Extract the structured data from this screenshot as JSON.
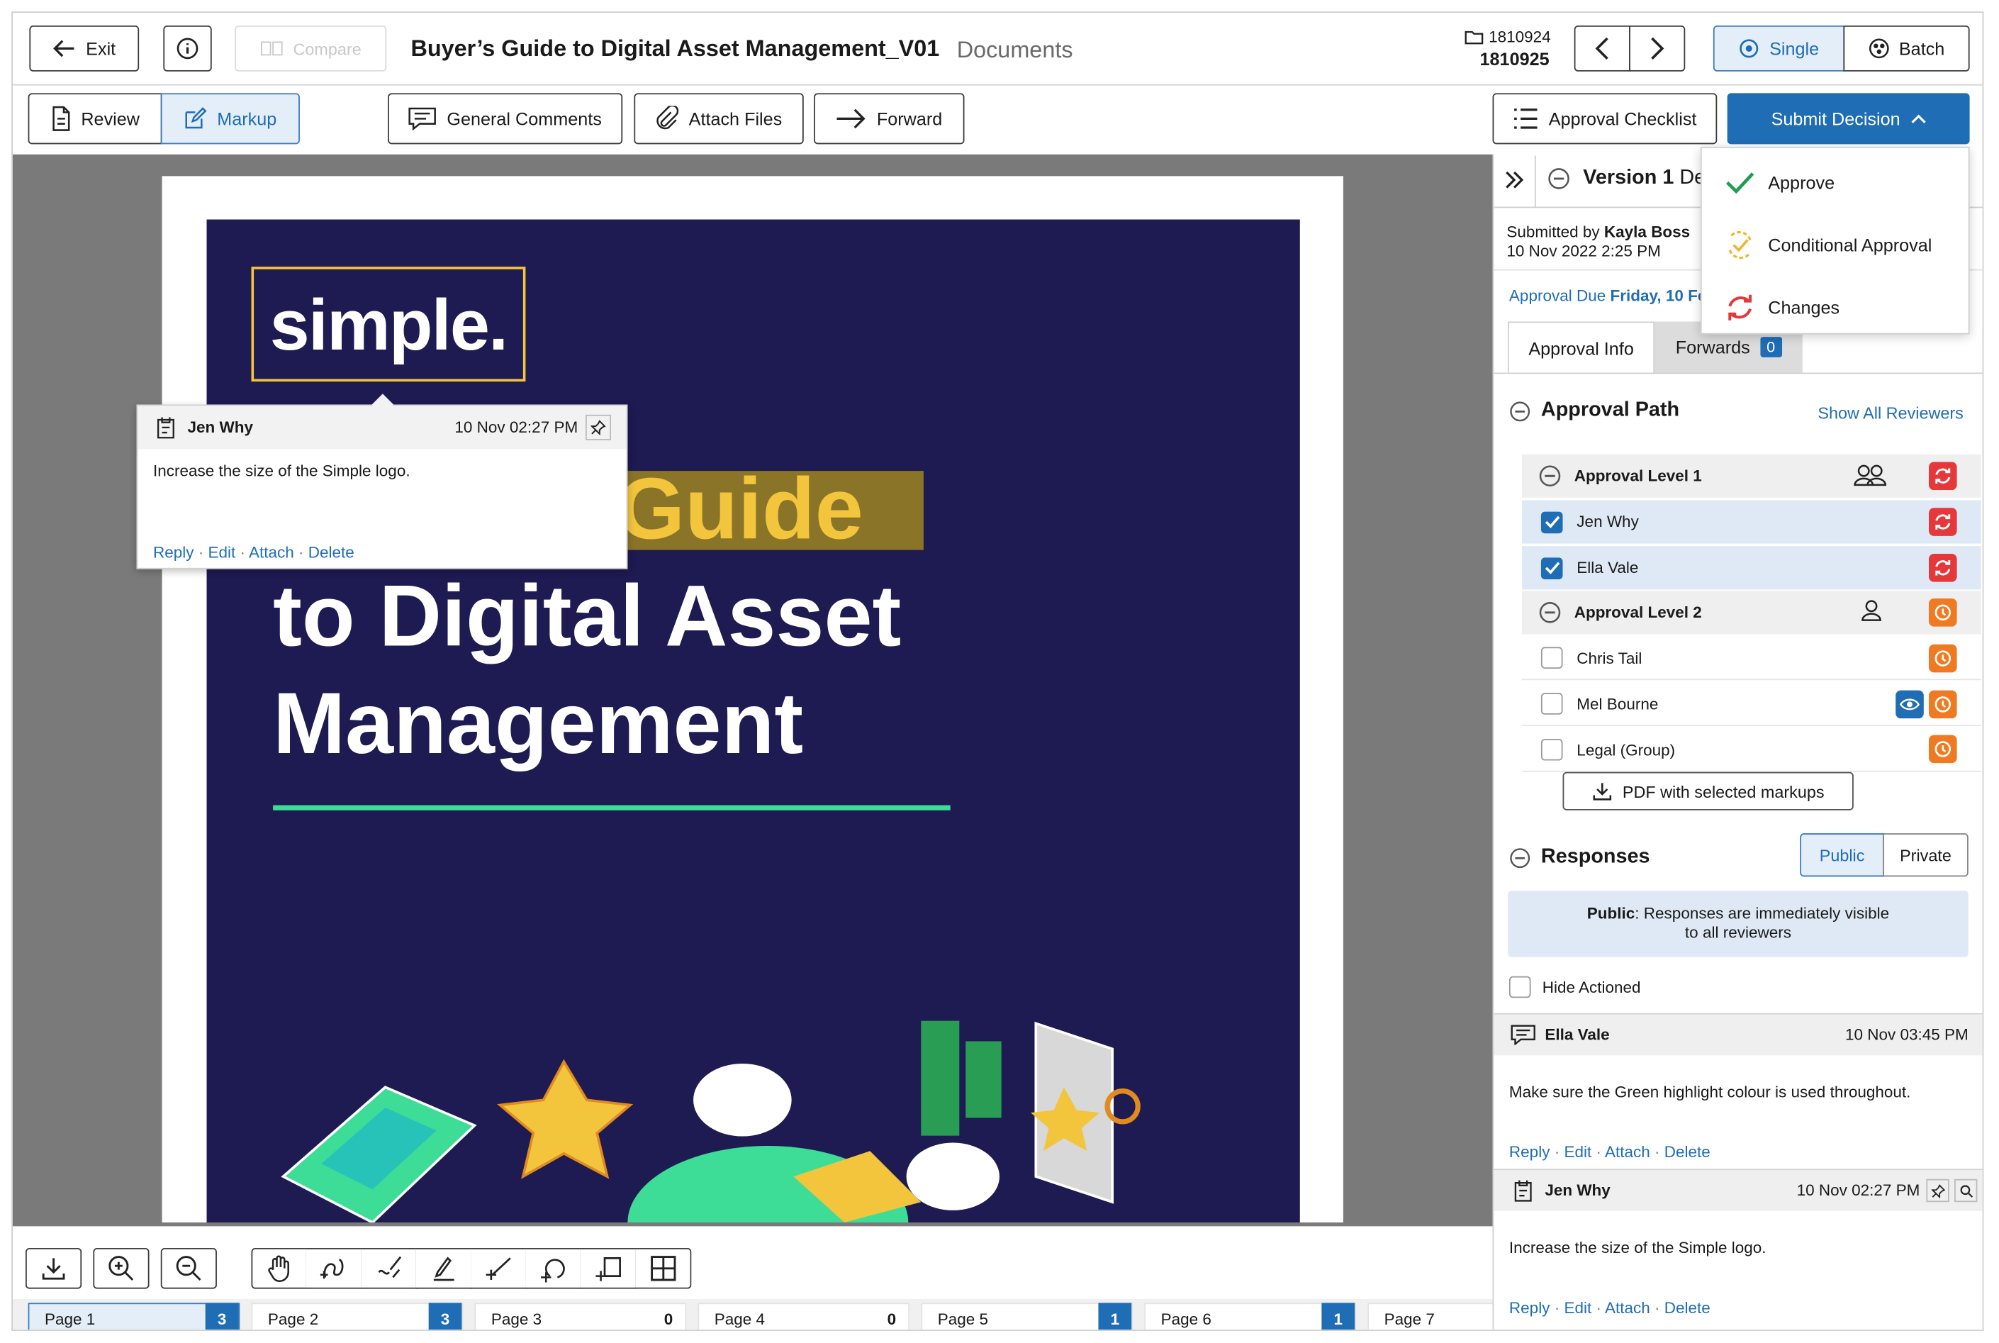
{
  "header": {
    "exit_label": "Exit",
    "compare_label": "Compare",
    "doc_title": "Buyer’s Guide to Digital Asset Management_V01",
    "doc_section": "Documents",
    "folder_id": "1810924",
    "doc_id": "1810925",
    "single_label": "Single",
    "batch_label": "Batch"
  },
  "toolbar": {
    "review_label": "Review",
    "markup_label": "Markup",
    "general_comments_label": "General Comments",
    "attach_files_label": "Attach Files",
    "forward_label": "Forward",
    "approval_checklist_label": "Approval Checklist",
    "submit_decision_label": "Submit Decision"
  },
  "decision_menu": {
    "items": [
      {
        "label": "Approve",
        "icon": "check-icon"
      },
      {
        "label": "Conditional Approval",
        "icon": "conditional-check-icon"
      },
      {
        "label": "Changes",
        "icon": "changes-cycle-icon"
      }
    ]
  },
  "document": {
    "logo_text": "simple.",
    "headline_line1": "Guide",
    "headline_line2": "to Digital Asset",
    "headline_line3": "Management",
    "colors": {
      "background": "#1e1a52",
      "accent_green": "#3ddc97",
      "highlight": "#8a7428",
      "logo_box": "#f2c53d"
    }
  },
  "popup_comment": {
    "author": "Jen Why",
    "timestamp": "10 Nov 02:27 PM",
    "text": "Increase the size of the Simple logo.",
    "actions": {
      "reply": "Reply",
      "edit": "Edit",
      "attach": "Attach",
      "delete": "Delete"
    }
  },
  "panel": {
    "version_label": "Version 1",
    "version_suffix": "De",
    "submitted_by_prefix": "Submitted by",
    "submitted_by": "Kayla Boss",
    "submitted_time": "10 Nov 2022 2:25 PM",
    "approval_due_prefix": "Approval Due",
    "approval_due_date": "Friday, 10 Fe",
    "tabs": {
      "approval_info": "Approval Info",
      "forwards": "Forwards",
      "forwards_count": "0"
    },
    "approval_path_title": "Approval Path",
    "show_all_reviewers": "Show All Reviewers",
    "levels": [
      {
        "name": "Approval Level 1"
      },
      {
        "name": "Approval Level 2"
      }
    ],
    "reviewers": {
      "r1": "Jen Why",
      "r2": "Ella Vale",
      "r3": "Chris Tail",
      "r4": "Mel Bourne",
      "r5": "Legal (Group)"
    },
    "pdf_button": "PDF with selected markups",
    "responses_title": "Responses",
    "public_label": "Public",
    "private_label": "Private",
    "public_info_bold": "Public",
    "public_info_text": ": Responses are immediately visible to all reviewers",
    "hide_actioned": "Hide Actioned",
    "comments": [
      {
        "author": "Ella Vale",
        "timestamp": "10 Nov 03:45 PM",
        "text": "Make sure the Green highlight colour is used throughout."
      },
      {
        "author": "Jen Why",
        "timestamp": "10 Nov 02:27 PM",
        "text": "Increase the size of the Simple logo."
      }
    ],
    "actions": {
      "reply": "Reply",
      "edit": "Edit",
      "attach": "Attach",
      "delete": "Delete"
    }
  },
  "pages": [
    {
      "label": "Page 1",
      "count": "3"
    },
    {
      "label": "Page 2",
      "count": "3"
    },
    {
      "label": "Page 3",
      "count": "0"
    },
    {
      "label": "Page 4",
      "count": "0"
    },
    {
      "label": "Page 5",
      "count": "1"
    },
    {
      "label": "Page 6",
      "count": "1"
    },
    {
      "label": "Page 7",
      "count": ""
    }
  ],
  "colors": {
    "accent": "#1f6db5",
    "changes": "#e5383b",
    "pending": "#f07a22",
    "canvas": "#7a7a7a"
  }
}
